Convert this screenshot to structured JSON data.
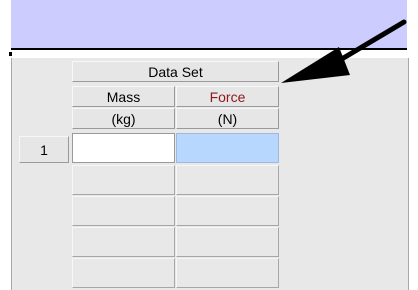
{
  "table": {
    "group_header": "Data Set",
    "columns": [
      {
        "name": "Mass",
        "unit": "(kg)"
      },
      {
        "name": "Force",
        "unit": "(N)"
      }
    ],
    "rows": [
      {
        "label": "1"
      }
    ]
  },
  "colors": {
    "title_band": "#ccccff",
    "force_header_text": "#8b1a1a",
    "selected_cell": "#b8d7ff"
  }
}
